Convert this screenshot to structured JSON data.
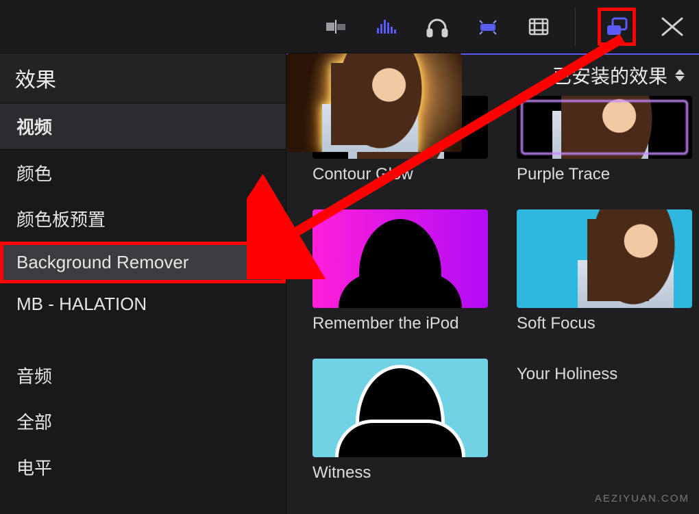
{
  "toolbar": {
    "icons": [
      "clips",
      "audio-meters",
      "headphones",
      "color-wheels",
      "filmstrip",
      "effects-browser",
      "transitions"
    ],
    "selected": "effects-browser"
  },
  "sidebar": {
    "title": "效果",
    "items": [
      {
        "label": "视频",
        "kind": "header"
      },
      {
        "label": "颜色",
        "kind": "item"
      },
      {
        "label": "颜色板预置",
        "kind": "item"
      },
      {
        "label": "Background Remover",
        "kind": "item",
        "selected": true
      },
      {
        "label": "MB - HALATION",
        "kind": "item"
      },
      {
        "label": "",
        "kind": "spacer"
      },
      {
        "label": "音频",
        "kind": "item"
      },
      {
        "label": "全部",
        "kind": "item"
      },
      {
        "label": "电平",
        "kind": "item"
      }
    ]
  },
  "content": {
    "installed_label": "已安装的效果",
    "effects": [
      {
        "name": "Contour Glow"
      },
      {
        "name": "Purple Trace"
      },
      {
        "name": "Remember the iPod"
      },
      {
        "name": "Soft Focus"
      },
      {
        "name": "Witness"
      },
      {
        "name": "Your Holiness"
      }
    ]
  },
  "watermark": "AEZIYUAN.COM",
  "colors": {
    "accent": "#5b5bfb",
    "annotation": "#ff0000"
  }
}
